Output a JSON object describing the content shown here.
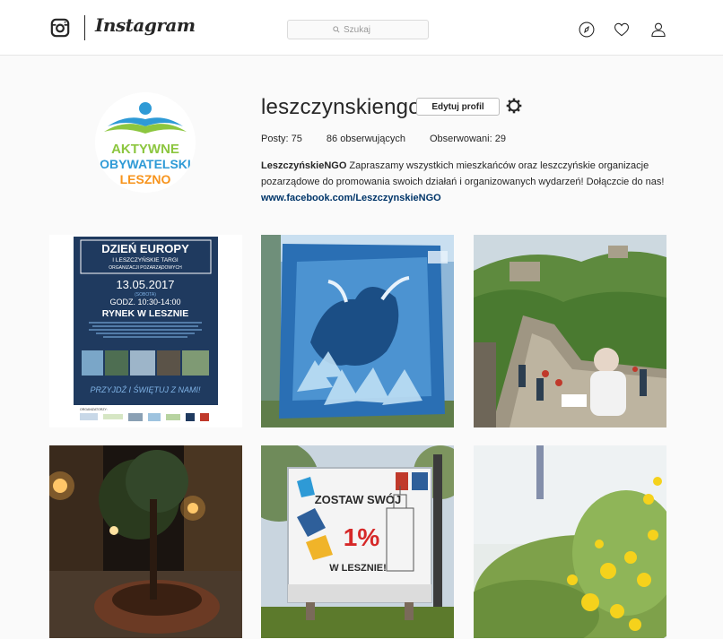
{
  "header": {
    "brand": "Instagram",
    "search": {
      "placeholder": "Szukaj"
    },
    "icons": [
      "instagram-glyph-icon",
      "explore-compass-icon",
      "activity-heart-icon",
      "profile-person-icon"
    ]
  },
  "profile": {
    "username": "leszczynskiengo",
    "edit_button": "Edytuj profil",
    "avatar_text": {
      "line1": "AKTYWNE",
      "line2": "OBYWATELSKI",
      "line3": "LESZNO"
    },
    "stats": {
      "posts_label": "Posty:",
      "posts": "75",
      "followers": "86",
      "followers_label": "obserwujących",
      "following_label": "Obserwowani:",
      "following": "29"
    },
    "bio": {
      "name": "LeszczyńskieNGO",
      "text": " Zapraszamy wszystkich mieszkańców oraz leszczyńskie organizacje pozarządowe do promowania swoich działań i organizowanych wydarzeń! Dołączcie do nas! ",
      "link": "www.facebook.com/LeszczynskieNGO"
    }
  },
  "posts": {
    "p1": {
      "title": "DZIEŃ EUROPY",
      "subtitle1": "I LESZCZYŃSKIE TARGI",
      "subtitle2": "ORGANIZACJI POZARZĄDOWYCH",
      "date": "13.05.2017",
      "day": "(SOBOTA)",
      "hours": "GODZ. 10:30-14:00",
      "place": "RYNEK W LESZNIE",
      "cta": "PRZYJDŹ I ŚWIĘTUJ Z NAMI!",
      "sponsors": "ORGANIZATORZY:"
    },
    "p5": {
      "line1": "ZOSTAW SWÓJ",
      "percent": "1%",
      "line2": "W LESZNIE!"
    }
  },
  "colors": {
    "poster_bg": "#1f3a5f",
    "poster_accent": "#7fb2e5",
    "link": "#003569",
    "logo_blue": "#2e9ad6",
    "logo_green": "#8cc63f",
    "logo_orange": "#f7941d"
  }
}
